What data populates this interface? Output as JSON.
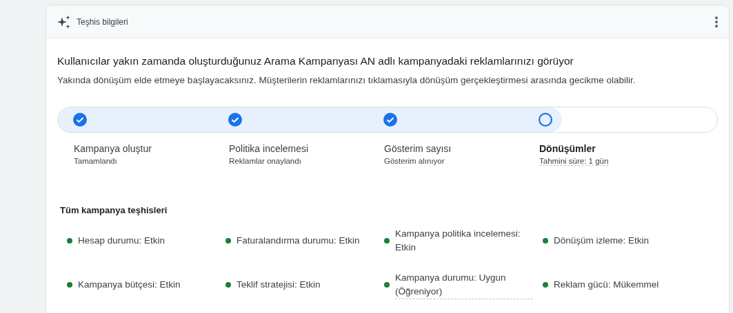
{
  "card": {
    "title": "Teşhis bilgileri"
  },
  "headline": "Kullanıcılar yakın zamanda oluşturduğunuz Arama Kampanyası AN adlı kampanyadaki reklamlarınızı görüyor",
  "description": "Yakında dönüşüm elde etmeye başlayacaksınız. Müşterilerin reklamlarınızı tıklamasıyla dönüşüm gerçekleştirmesi arasında gecikme olabilir.",
  "progress": {
    "level": 0.765
  },
  "steps": [
    {
      "title": "Kampanya oluştur",
      "subtitle": "Tamamlandı",
      "completed": true,
      "current": false
    },
    {
      "title": "Politika incelemesi",
      "subtitle": "Reklamlar onaylandı",
      "completed": true,
      "current": false
    },
    {
      "title": "Gösterim sayısı",
      "subtitle": "Gösterim alınıyor",
      "completed": true,
      "current": false
    },
    {
      "title": "Dönüşümler",
      "subtitle": "Tahmini süre: 1 gün",
      "completed": false,
      "current": true
    }
  ],
  "diagnostics": {
    "title": "Tüm kampanya teşhisleri",
    "items": [
      {
        "label": "Hesap durumu: Etkin",
        "underlined": false
      },
      {
        "label": "Faturalandırma durumu: Etkin",
        "underlined": false
      },
      {
        "label": "Kampanya politika incelemesi: Etkin",
        "underlined": false
      },
      {
        "label": "Dönüşüm izleme: Etkin",
        "underlined": false
      },
      {
        "label": "Kampanya bütçesi: Etkin",
        "underlined": false
      },
      {
        "label": "Teklif stratejisi: Etkin",
        "underlined": false
      },
      {
        "label": "Kampanya durumu: Uygun (Öğreniyor)",
        "underlined": true
      },
      {
        "label": "Reklam gücü: Mükemmel",
        "underlined": false
      }
    ]
  }
}
